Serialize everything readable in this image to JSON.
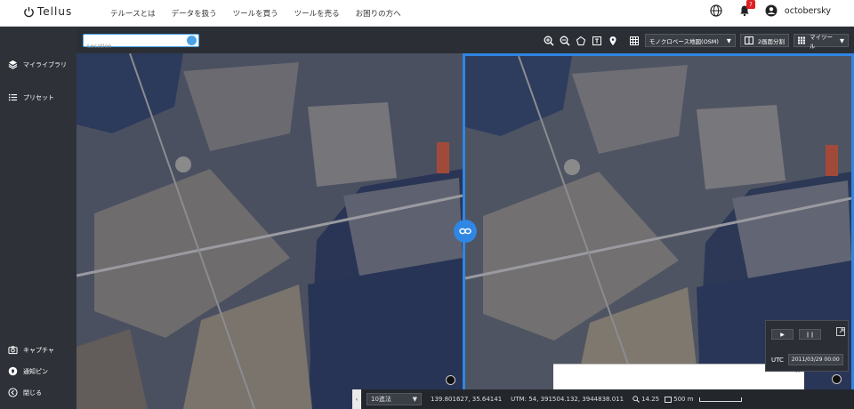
{
  "header": {
    "logo_text": "Tellus",
    "nav": [
      "テルースとは",
      "データを扱う",
      "ツールを買う",
      "ツールを売る",
      "お困りの方へ"
    ],
    "notification_count": "7",
    "username": "octobersky"
  },
  "sidebar": {
    "top_items": [
      {
        "label": "マイライブラリ",
        "icon": "layers-icon"
      },
      {
        "label": "プリセット",
        "icon": "list-icon"
      }
    ],
    "bottom_items": [
      {
        "label": "キャプチャ",
        "icon": "camera-icon"
      },
      {
        "label": "通知ピン",
        "icon": "pin-icon"
      },
      {
        "label": "閉じる",
        "icon": "close-circle-icon"
      }
    ]
  },
  "toolbar": {
    "search_placeholder": "Location",
    "basemap_select": "モノクロベース地図(OSM)",
    "split_label": "2画面分割",
    "mytool_label": "マイツール"
  },
  "statusbar": {
    "toggle_glyph": "‹",
    "projection": "10進法",
    "latlon": "139.801627, 35.64141",
    "utm": "UTM: 54, 391504.132, 3944838.011",
    "zoom": "14.25",
    "scale": "500 m"
  },
  "timepanel": {
    "play": "▶",
    "pause": "❚❚",
    "utc_label": "UTC",
    "datetime": "2011/03/29 00:00"
  },
  "colors": {
    "accent": "#2f86e4",
    "sidebar_bg": "#2e3238",
    "badge": "#e02020"
  }
}
